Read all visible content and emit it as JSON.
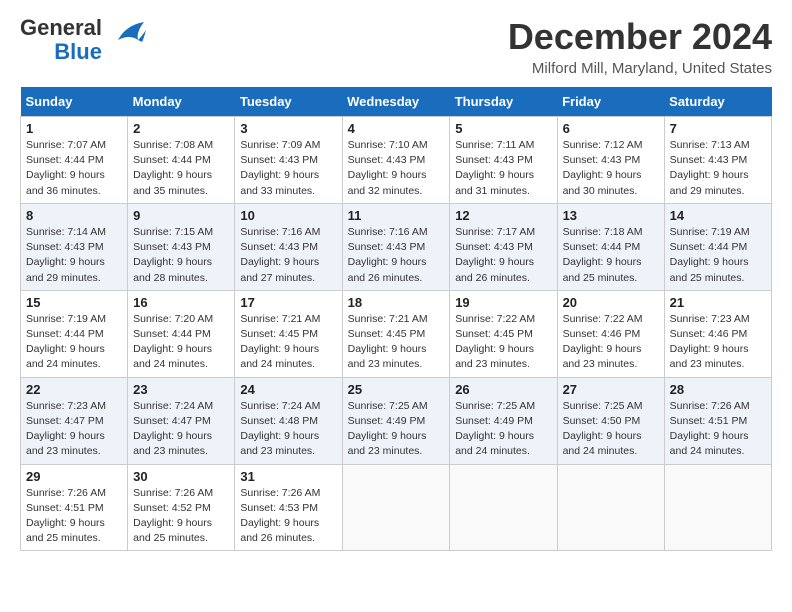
{
  "logo": {
    "line1": "General",
    "line2": "Blue"
  },
  "title": "December 2024",
  "location": "Milford Mill, Maryland, United States",
  "days_of_week": [
    "Sunday",
    "Monday",
    "Tuesday",
    "Wednesday",
    "Thursday",
    "Friday",
    "Saturday"
  ],
  "weeks": [
    [
      {
        "day": "1",
        "sunrise": "Sunrise: 7:07 AM",
        "sunset": "Sunset: 4:44 PM",
        "daylight": "Daylight: 9 hours and 36 minutes."
      },
      {
        "day": "2",
        "sunrise": "Sunrise: 7:08 AM",
        "sunset": "Sunset: 4:44 PM",
        "daylight": "Daylight: 9 hours and 35 minutes."
      },
      {
        "day": "3",
        "sunrise": "Sunrise: 7:09 AM",
        "sunset": "Sunset: 4:43 PM",
        "daylight": "Daylight: 9 hours and 33 minutes."
      },
      {
        "day": "4",
        "sunrise": "Sunrise: 7:10 AM",
        "sunset": "Sunset: 4:43 PM",
        "daylight": "Daylight: 9 hours and 32 minutes."
      },
      {
        "day": "5",
        "sunrise": "Sunrise: 7:11 AM",
        "sunset": "Sunset: 4:43 PM",
        "daylight": "Daylight: 9 hours and 31 minutes."
      },
      {
        "day": "6",
        "sunrise": "Sunrise: 7:12 AM",
        "sunset": "Sunset: 4:43 PM",
        "daylight": "Daylight: 9 hours and 30 minutes."
      },
      {
        "day": "7",
        "sunrise": "Sunrise: 7:13 AM",
        "sunset": "Sunset: 4:43 PM",
        "daylight": "Daylight: 9 hours and 29 minutes."
      }
    ],
    [
      {
        "day": "8",
        "sunrise": "Sunrise: 7:14 AM",
        "sunset": "Sunset: 4:43 PM",
        "daylight": "Daylight: 9 hours and 29 minutes."
      },
      {
        "day": "9",
        "sunrise": "Sunrise: 7:15 AM",
        "sunset": "Sunset: 4:43 PM",
        "daylight": "Daylight: 9 hours and 28 minutes."
      },
      {
        "day": "10",
        "sunrise": "Sunrise: 7:16 AM",
        "sunset": "Sunset: 4:43 PM",
        "daylight": "Daylight: 9 hours and 27 minutes."
      },
      {
        "day": "11",
        "sunrise": "Sunrise: 7:16 AM",
        "sunset": "Sunset: 4:43 PM",
        "daylight": "Daylight: 9 hours and 26 minutes."
      },
      {
        "day": "12",
        "sunrise": "Sunrise: 7:17 AM",
        "sunset": "Sunset: 4:43 PM",
        "daylight": "Daylight: 9 hours and 26 minutes."
      },
      {
        "day": "13",
        "sunrise": "Sunrise: 7:18 AM",
        "sunset": "Sunset: 4:44 PM",
        "daylight": "Daylight: 9 hours and 25 minutes."
      },
      {
        "day": "14",
        "sunrise": "Sunrise: 7:19 AM",
        "sunset": "Sunset: 4:44 PM",
        "daylight": "Daylight: 9 hours and 25 minutes."
      }
    ],
    [
      {
        "day": "15",
        "sunrise": "Sunrise: 7:19 AM",
        "sunset": "Sunset: 4:44 PM",
        "daylight": "Daylight: 9 hours and 24 minutes."
      },
      {
        "day": "16",
        "sunrise": "Sunrise: 7:20 AM",
        "sunset": "Sunset: 4:44 PM",
        "daylight": "Daylight: 9 hours and 24 minutes."
      },
      {
        "day": "17",
        "sunrise": "Sunrise: 7:21 AM",
        "sunset": "Sunset: 4:45 PM",
        "daylight": "Daylight: 9 hours and 24 minutes."
      },
      {
        "day": "18",
        "sunrise": "Sunrise: 7:21 AM",
        "sunset": "Sunset: 4:45 PM",
        "daylight": "Daylight: 9 hours and 23 minutes."
      },
      {
        "day": "19",
        "sunrise": "Sunrise: 7:22 AM",
        "sunset": "Sunset: 4:45 PM",
        "daylight": "Daylight: 9 hours and 23 minutes."
      },
      {
        "day": "20",
        "sunrise": "Sunrise: 7:22 AM",
        "sunset": "Sunset: 4:46 PM",
        "daylight": "Daylight: 9 hours and 23 minutes."
      },
      {
        "day": "21",
        "sunrise": "Sunrise: 7:23 AM",
        "sunset": "Sunset: 4:46 PM",
        "daylight": "Daylight: 9 hours and 23 minutes."
      }
    ],
    [
      {
        "day": "22",
        "sunrise": "Sunrise: 7:23 AM",
        "sunset": "Sunset: 4:47 PM",
        "daylight": "Daylight: 9 hours and 23 minutes."
      },
      {
        "day": "23",
        "sunrise": "Sunrise: 7:24 AM",
        "sunset": "Sunset: 4:47 PM",
        "daylight": "Daylight: 9 hours and 23 minutes."
      },
      {
        "day": "24",
        "sunrise": "Sunrise: 7:24 AM",
        "sunset": "Sunset: 4:48 PM",
        "daylight": "Daylight: 9 hours and 23 minutes."
      },
      {
        "day": "25",
        "sunrise": "Sunrise: 7:25 AM",
        "sunset": "Sunset: 4:49 PM",
        "daylight": "Daylight: 9 hours and 23 minutes."
      },
      {
        "day": "26",
        "sunrise": "Sunrise: 7:25 AM",
        "sunset": "Sunset: 4:49 PM",
        "daylight": "Daylight: 9 hours and 24 minutes."
      },
      {
        "day": "27",
        "sunrise": "Sunrise: 7:25 AM",
        "sunset": "Sunset: 4:50 PM",
        "daylight": "Daylight: 9 hours and 24 minutes."
      },
      {
        "day": "28",
        "sunrise": "Sunrise: 7:26 AM",
        "sunset": "Sunset: 4:51 PM",
        "daylight": "Daylight: 9 hours and 24 minutes."
      }
    ],
    [
      {
        "day": "29",
        "sunrise": "Sunrise: 7:26 AM",
        "sunset": "Sunset: 4:51 PM",
        "daylight": "Daylight: 9 hours and 25 minutes."
      },
      {
        "day": "30",
        "sunrise": "Sunrise: 7:26 AM",
        "sunset": "Sunset: 4:52 PM",
        "daylight": "Daylight: 9 hours and 25 minutes."
      },
      {
        "day": "31",
        "sunrise": "Sunrise: 7:26 AM",
        "sunset": "Sunset: 4:53 PM",
        "daylight": "Daylight: 9 hours and 26 minutes."
      },
      null,
      null,
      null,
      null
    ]
  ]
}
